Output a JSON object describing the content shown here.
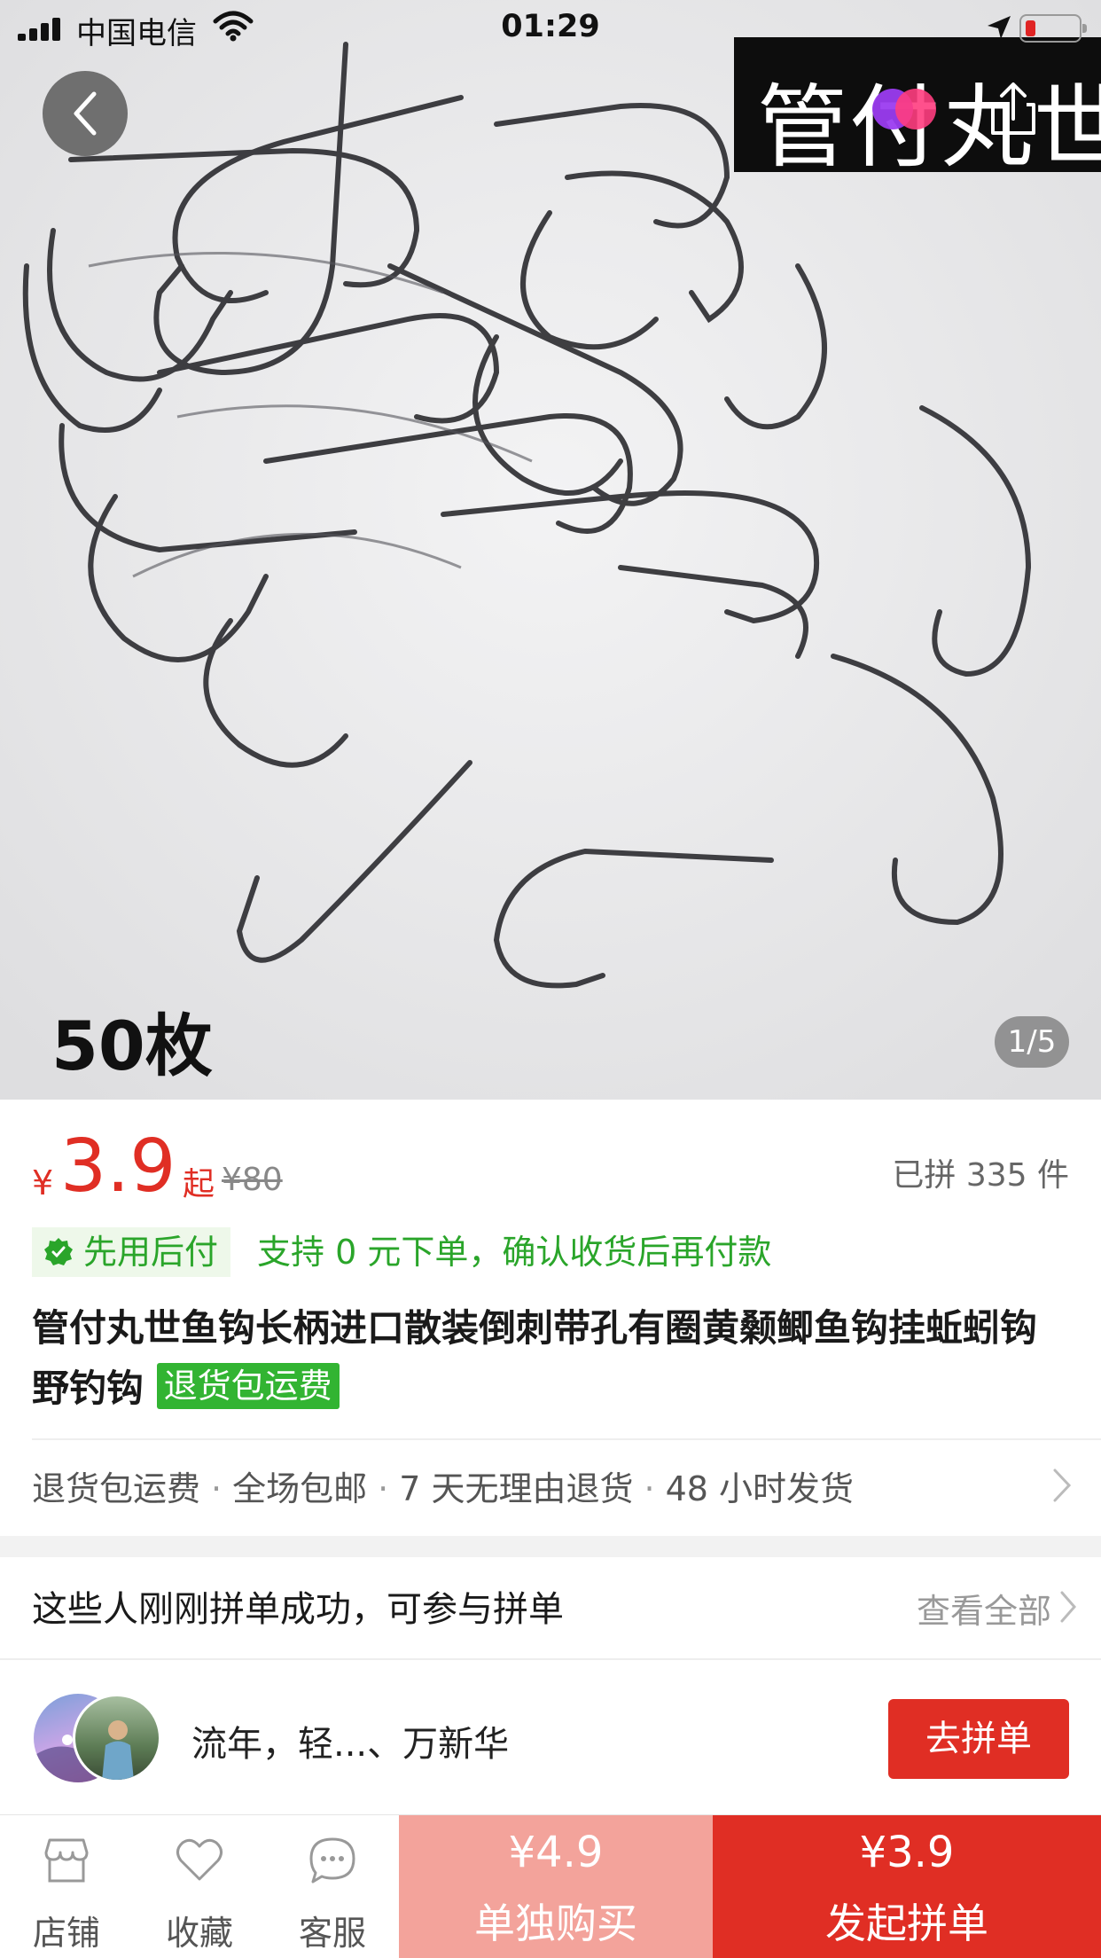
{
  "status_bar": {
    "carrier": "中国电信",
    "time": "01:29",
    "icons": [
      "signal-icon",
      "wifi-icon",
      "location-arrow-icon",
      "battery-icon"
    ]
  },
  "hero": {
    "brand_text": "管付丸世",
    "count_label": "50枚",
    "page_indicator": "1/5",
    "icons": [
      "back-arrow-icon",
      "share-icon"
    ]
  },
  "info": {
    "currency": "¥",
    "price": "3.9",
    "price_suffix": "起",
    "original_price": "¥80",
    "sold": "已拼 335 件",
    "pay_later_tag": "先用后付",
    "pay_later_desc": "支持 0 元下单，确认收货后再付款",
    "title": "管付丸世鱼钩长柄进口散装倒刺带孔有圈黄颡鲫鱼钩挂蚯蚓钩野钓钩",
    "title_tag": "退货包运费",
    "services": [
      "退货包运费",
      "全场包邮",
      "7 天无理由退货",
      "48 小时发货"
    ]
  },
  "group_buy": {
    "heading": "这些人刚刚拼单成功，可参与拼单",
    "see_all": "查看全部",
    "names": "流年，轻...、万新华",
    "join_button": "去拼单"
  },
  "bottom_bar": {
    "store": "店铺",
    "favorite": "收藏",
    "service": "客服",
    "buy_alone_price": "¥4.9",
    "buy_alone_label": "单独购买",
    "buy_group_price": "¥3.9",
    "buy_group_label": "发起拼单"
  },
  "colors": {
    "accent_red": "#e02e24",
    "pink_button": "#f3a39b",
    "green": "#2aa52a"
  }
}
